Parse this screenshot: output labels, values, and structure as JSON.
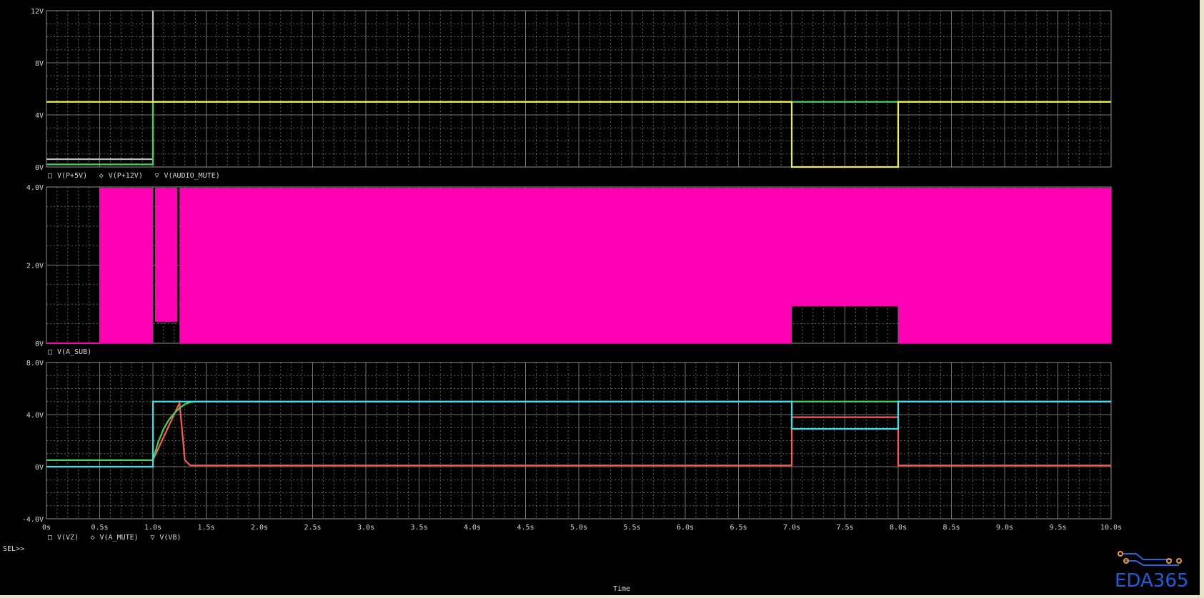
{
  "window": {
    "x_axis_title": "Time",
    "sel_marker": "SEL>>"
  },
  "watermark": {
    "text": "EDA365"
  },
  "colors": {
    "background": "#000000",
    "grid": "#8a8a8a",
    "green": "#3fd35a",
    "gray": "#bdbdbd",
    "yellow": "#f0f044",
    "magenta": "#ff00b4",
    "salmon": "#ff5a4a",
    "cyan": "#39e0ea",
    "text": "#d8d8d8",
    "frame": "#e9e4c9"
  },
  "chart_data": [
    {
      "type": "line",
      "id": "top",
      "xlim": [
        0,
        10
      ],
      "ylim": [
        0,
        12
      ],
      "yticks": [
        0,
        4,
        8,
        12
      ],
      "ytick_labels": [
        "0V",
        "4V",
        "8V",
        "12V"
      ],
      "legend": [
        {
          "name": "V(P+5V)",
          "marker": "□",
          "color": "#3fd35a"
        },
        {
          "name": "V(P+12V)",
          "marker": "◇",
          "color": "#bdbdbd"
        },
        {
          "name": "V(AUDIO_MUTE)",
          "marker": "▽",
          "color": "#f0f044"
        }
      ],
      "series": [
        {
          "name": "V(P+12V)",
          "color": "#bdbdbd",
          "marker": "◇",
          "x": [
            0,
            1.0,
            1.0,
            1.0
          ],
          "y": [
            0.6,
            0.6,
            6,
            12
          ]
        },
        {
          "name": "V(P+5V)",
          "color": "#3fd35a",
          "marker": "□",
          "x": [
            0,
            1.0,
            1.0,
            7.0,
            7.0,
            8.0,
            8.0,
            10.0
          ],
          "y": [
            0.2,
            0.2,
            5.0,
            5.0,
            5.0,
            5.0,
            5.0,
            5.0
          ]
        },
        {
          "name": "V(AUDIO_MUTE)",
          "color": "#f0f044",
          "marker": "▽",
          "x": [
            0,
            7.0,
            7.0,
            8.0,
            8.0,
            10.0
          ],
          "y": [
            5.0,
            5.0,
            0.0,
            0.0,
            5.0,
            5.0
          ]
        }
      ]
    },
    {
      "type": "area",
      "id": "middle",
      "xlim": [
        0,
        10
      ],
      "ylim": [
        0,
        4
      ],
      "yticks": [
        0,
        2,
        4
      ],
      "ytick_labels": [
        "0V",
        "2.0V",
        "4.0V"
      ],
      "legend": [
        {
          "name": "V(A_SUB)",
          "marker": "□",
          "color": "#ff00b4"
        }
      ],
      "series": [
        {
          "name": "V(A_SUB)",
          "color": "#ff00b4",
          "bands": [
            {
              "x0": 0.5,
              "x1": 1.0,
              "ymin": 0.0,
              "ymax": 3.98
            },
            {
              "x0": 1.02,
              "x1": 1.23,
              "ymin": 0.55,
              "ymax": 3.98
            },
            {
              "x0": 1.25,
              "x1": 7.0,
              "ymin": 0.0,
              "ymax": 3.98
            },
            {
              "x0": 7.0,
              "x1": 8.0,
              "ymin": 0.95,
              "ymax": 3.98
            },
            {
              "x0": 8.0,
              "x1": 10.0,
              "ymin": 0.0,
              "ymax": 3.98
            }
          ],
          "baseline": {
            "x0": 0,
            "x1": 0.5,
            "y": 0.0
          }
        }
      ]
    },
    {
      "type": "line",
      "id": "bottom",
      "xlim": [
        0,
        10
      ],
      "ylim": [
        -4,
        8
      ],
      "yticks": [
        -4,
        0,
        4,
        8
      ],
      "ytick_labels": [
        "-4.0V",
        "0V",
        "4.0V",
        "8.0V"
      ],
      "xticks": [
        0,
        0.5,
        1.0,
        1.5,
        2.0,
        2.5,
        3.0,
        3.5,
        4.0,
        4.5,
        5.0,
        5.5,
        6.0,
        6.5,
        7.0,
        7.5,
        8.0,
        8.5,
        9.0,
        9.5,
        10.0
      ],
      "xtick_labels": [
        "0s",
        "0.5s",
        "1.0s",
        "1.5s",
        "2.0s",
        "2.5s",
        "3.0s",
        "3.5s",
        "4.0s",
        "4.5s",
        "5.0s",
        "5.5s",
        "6.0s",
        "6.5s",
        "7.0s",
        "7.5s",
        "8.0s",
        "8.5s",
        "9.0s",
        "9.5s",
        "10.0s"
      ],
      "xlabel": "Time",
      "legend": [
        {
          "name": "V(VZ)",
          "marker": "□",
          "color": "#3fd35a"
        },
        {
          "name": "V(A_MUTE)",
          "marker": "◇",
          "color": "#ff5a4a"
        },
        {
          "name": "V(VB)",
          "marker": "▽",
          "color": "#39e0ea"
        }
      ],
      "series": [
        {
          "name": "V(A_MUTE)",
          "color": "#ff5a4a",
          "marker": "◇",
          "x": [
            0,
            1.0,
            1.0,
            1.25,
            1.3,
            1.35,
            7.0,
            7.0,
            8.0,
            8.0,
            10.0
          ],
          "y": [
            0.5,
            0.5,
            0.5,
            4.9,
            0.5,
            0.1,
            0.1,
            3.8,
            3.8,
            0.1,
            0.1
          ]
        },
        {
          "name": "V(VZ)",
          "color": "#3fd35a",
          "marker": "□",
          "x": [
            0,
            1.0,
            1.05,
            1.1,
            1.15,
            1.2,
            1.25,
            1.3,
            1.35,
            1.4,
            10.0
          ],
          "y": [
            0.5,
            0.5,
            1.9,
            2.9,
            3.6,
            4.1,
            4.5,
            4.8,
            4.95,
            5.0,
            5.0
          ]
        },
        {
          "name": "V(VB)",
          "color": "#39e0ea",
          "marker": "▽",
          "x": [
            0,
            1.0,
            1.0,
            7.0,
            7.0,
            8.0,
            8.0,
            10.0
          ],
          "y": [
            0.0,
            0.0,
            5.0,
            5.0,
            2.9,
            2.9,
            5.0,
            5.0
          ]
        }
      ]
    }
  ]
}
